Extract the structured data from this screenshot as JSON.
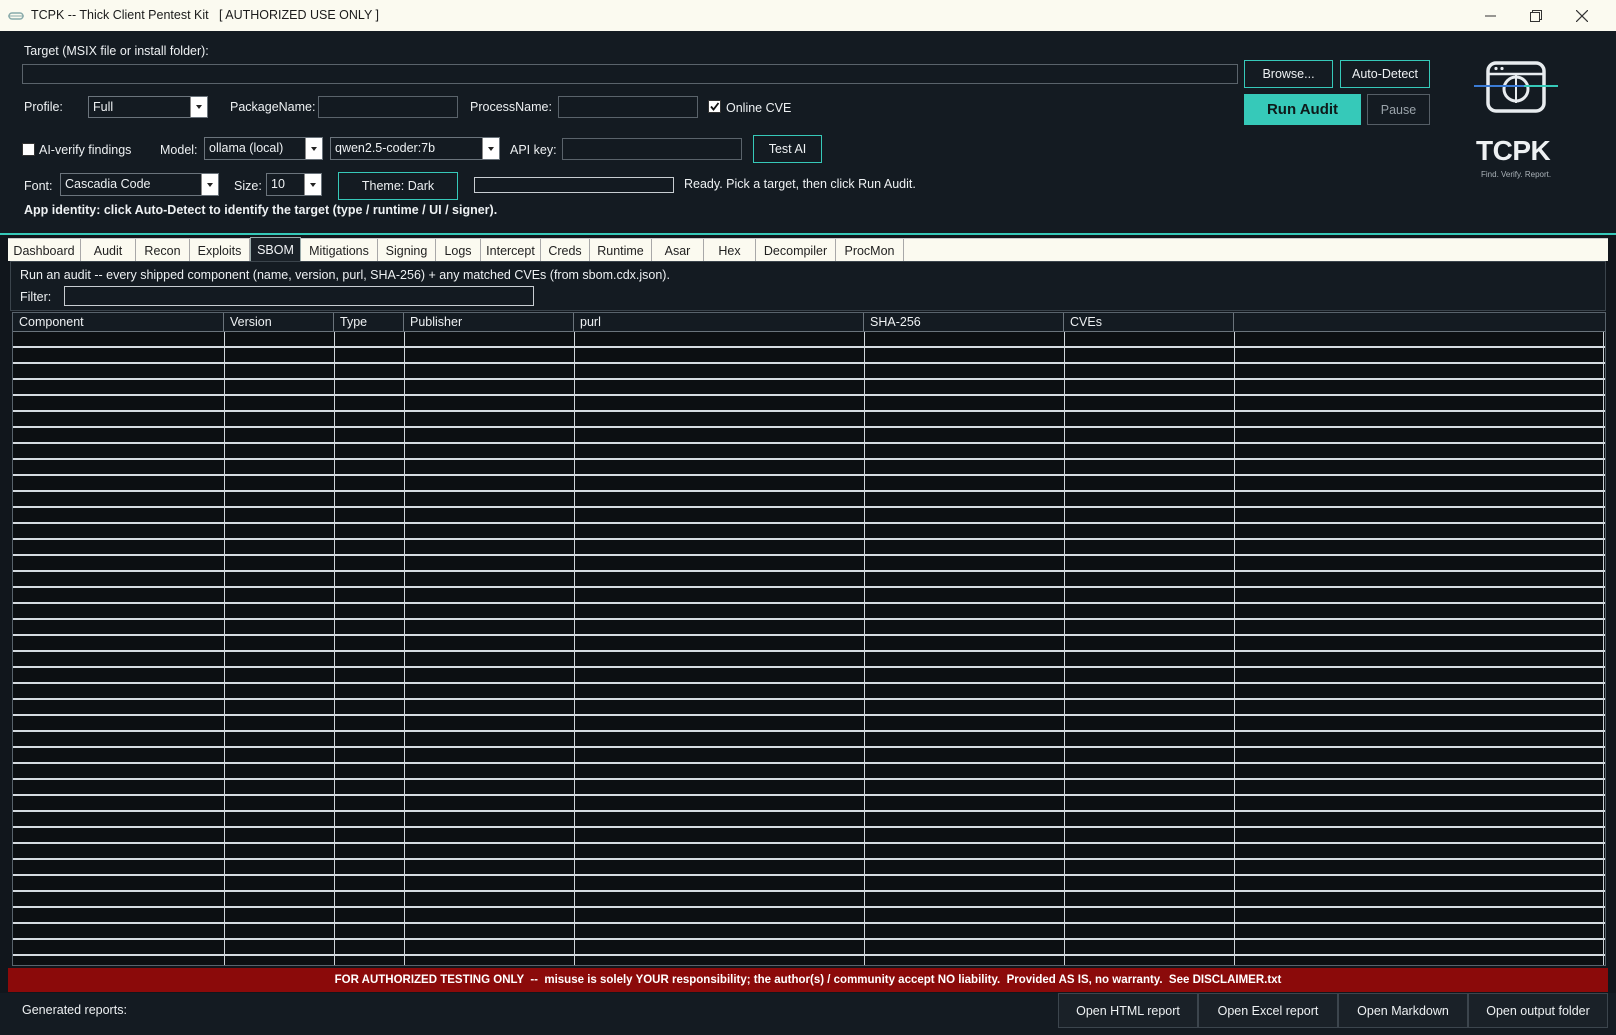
{
  "window": {
    "title": "TCPK -- Thick Client Pentest Kit   [ AUTHORIZED USE ONLY ]",
    "minimize_glyph": "—",
    "maximize_glyph": "❐",
    "close_glyph": "✕"
  },
  "target": {
    "label": "Target (MSIX file or install folder):",
    "value": "",
    "browse_label": "Browse...",
    "autodetect_label": "Auto-Detect"
  },
  "profile": {
    "label": "Profile:",
    "value": "Full"
  },
  "package_name": {
    "label": "PackageName:",
    "value": ""
  },
  "process_name": {
    "label": "ProcessName:",
    "value": ""
  },
  "online_cve": {
    "label": "Online CVE",
    "checked": true
  },
  "run_audit_label": "Run Audit",
  "pause_label": "Pause",
  "ai": {
    "verify_label": "AI-verify findings",
    "verify_checked": false,
    "model_label": "Model:",
    "model_value": "ollama (local)",
    "model_name_value": "qwen2.5-coder:7b",
    "api_key_label": "API key:",
    "api_key_value": "",
    "test_label": "Test AI"
  },
  "font": {
    "label": "Font:",
    "value": "Cascadia Code",
    "size_label": "Size:",
    "size_value": "10",
    "theme_label": "Theme: Dark"
  },
  "status_text": "Ready. Pick a target, then click Run Audit.",
  "progress": 0,
  "identity_text": "App identity: click Auto-Detect to identify the target (type / runtime / UI / signer).",
  "logo": {
    "title": "TCPK",
    "tagline": "Find. Verify. Report.",
    "icon": "crosshair-window-icon"
  },
  "tabs": [
    {
      "label": "Dashboard"
    },
    {
      "label": "Audit"
    },
    {
      "label": "Recon"
    },
    {
      "label": "Exploits"
    },
    {
      "label": "SBOM"
    },
    {
      "label": "Mitigations"
    },
    {
      "label": "Signing"
    },
    {
      "label": "Logs"
    },
    {
      "label": "Intercept"
    },
    {
      "label": "Creds"
    },
    {
      "label": "Runtime"
    },
    {
      "label": "Asar"
    },
    {
      "label": "Hex"
    },
    {
      "label": "Decompiler"
    },
    {
      "label": "ProcMon"
    }
  ],
  "active_tab": "SBOM",
  "sbom": {
    "description": "Run an audit -- every shipped component (name, version, purl, SHA-256) + any matched CVEs (from sbom.cdx.json).",
    "filter_label": "Filter:",
    "filter_value": "",
    "columns": [
      "Component",
      "Version",
      "Type",
      "Publisher",
      "purl",
      "SHA-256",
      "CVEs"
    ],
    "rows": []
  },
  "disclaimer": "FOR AUTHORIZED TESTING ONLY  --  misuse is solely YOUR responsibility; the author(s) / community accept NO liability.  Provided AS IS, no warranty.  See DISCLAIMER.txt",
  "footer": {
    "generated_label": "Generated reports:",
    "buttons": [
      "Open HTML report",
      "Open Excel report",
      "Open Markdown",
      "Open output folder"
    ]
  },
  "colors": {
    "accent": "#36c9b9",
    "background": "#141b22",
    "disclaimer_bg": "#8b0a0a",
    "titlebar": "#fbfaf0"
  }
}
